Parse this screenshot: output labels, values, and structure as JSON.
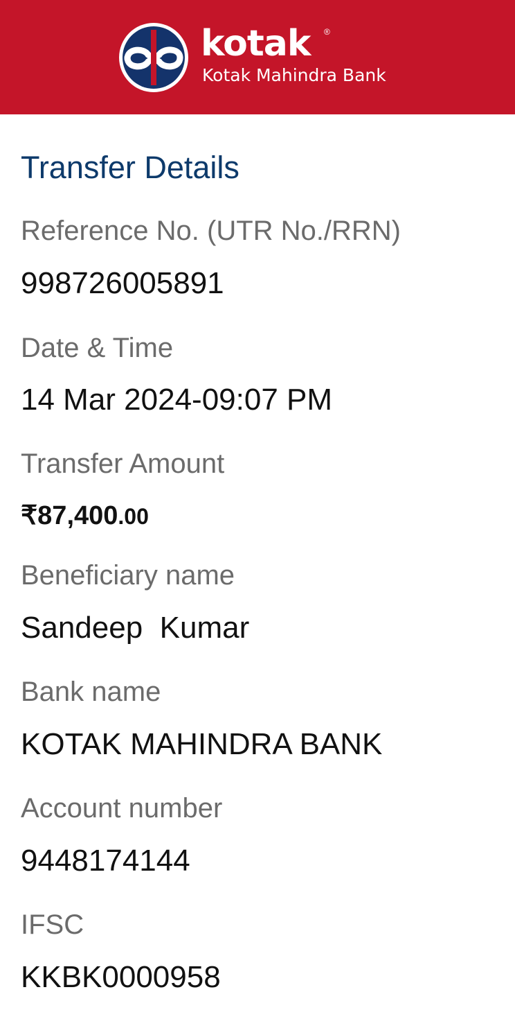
{
  "header": {
    "brand_name": "kotak",
    "registered_mark": "®",
    "brand_subtitle": "Kotak Mahindra Bank",
    "colors": {
      "header_bg": "#c41529",
      "logo_circle": "#14336b",
      "title_blue": "#0d3a6b"
    }
  },
  "transfer": {
    "title": "Transfer Details",
    "reference_label": "Reference No. (UTR No./RRN)",
    "reference_value": "998726005891",
    "datetime_label": "Date & Time",
    "datetime_value": "14 Mar 2024-09:07 PM",
    "amount_label": "Transfer Amount",
    "amount_main": "₹87,400",
    "amount_paise": ".00",
    "beneficiary_label": "Beneficiary name",
    "beneficiary_value": "Sandeep  Kumar",
    "bank_label": "Bank name",
    "bank_value": "KOTAK MAHINDRA BANK",
    "account_label": "Account number",
    "account_value": "9448174144",
    "ifsc_label": "IFSC",
    "ifsc_value": "KKBK0000958"
  }
}
